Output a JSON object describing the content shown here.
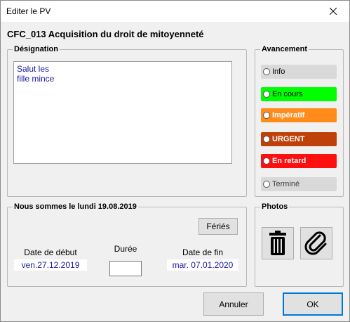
{
  "window": {
    "title": "Editer le PV"
  },
  "heading": "CFC_013 Acquisition du droit de mitoyenneté",
  "designation": {
    "legend": "Désignation",
    "text": "Salut les\nfille mince"
  },
  "avancement": {
    "legend": "Avancement",
    "options": [
      {
        "label": "Info",
        "color": "#d4d4d4",
        "text_color": "#000000",
        "selected": false
      },
      {
        "label": "En cours",
        "color": "#00ff00",
        "text_color": "#000000",
        "selected": false
      },
      {
        "label": "Impératif",
        "color": "#ff8c1a",
        "text_color": "#ffffff",
        "selected": false
      },
      {
        "label": "URGENT",
        "color": "#c0400a",
        "text_color": "#ffffff",
        "selected": false
      },
      {
        "label": "En retard",
        "color": "#ff1010",
        "text_color": "#ffffff",
        "selected": false
      },
      {
        "label": "Terminé",
        "color": "#d4d4d4",
        "text_color": "#404040",
        "selected": false
      }
    ]
  },
  "dates": {
    "legend": "Nous sommes le lundi 19.08.2019",
    "feries_label": "Fériés",
    "start_label": "Date de début",
    "start_value": "ven.27.12.2019",
    "duration_label": "Durée",
    "duration_value": "",
    "end_label": "Date de fin",
    "end_value": "mar. 07.01.2020"
  },
  "photos": {
    "legend": "Photos",
    "buttons": [
      "trash-icon",
      "paperclip-icon"
    ]
  },
  "buttons": {
    "cancel": "Annuler",
    "ok": "OK"
  }
}
